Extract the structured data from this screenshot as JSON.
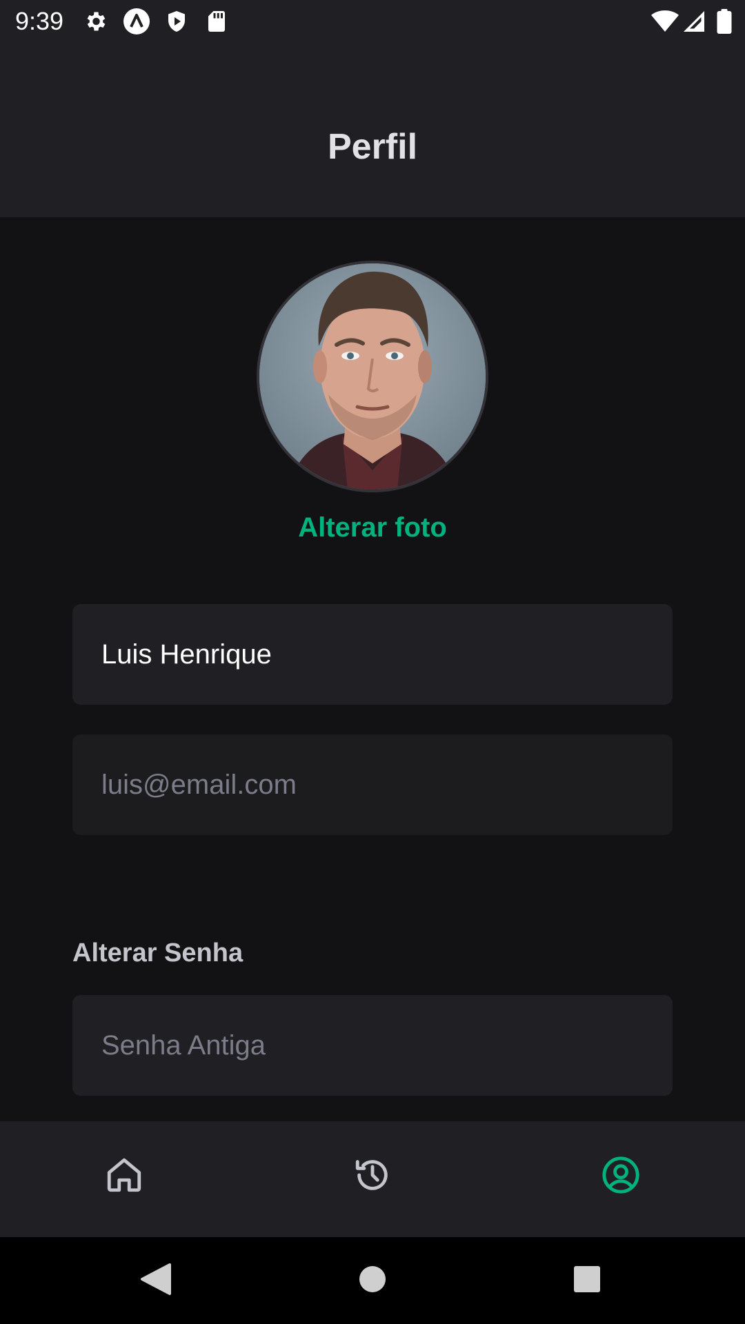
{
  "status_bar": {
    "time": "9:39",
    "icons": [
      "gear-icon",
      "a-logo-icon",
      "play-shield-icon",
      "sd-card-icon",
      "wifi-icon",
      "signal-icon",
      "battery-icon"
    ]
  },
  "header": {
    "title": "Perfil"
  },
  "profile": {
    "change_photo_label": "Alterar foto"
  },
  "form": {
    "name_value": "Luis Henrique",
    "email_value": "luis@email.com",
    "password_section_title": "Alterar Senha",
    "old_password_placeholder": "Senha Antiga"
  },
  "tab_bar": {
    "items": [
      "home-icon",
      "history-icon",
      "user-circle-icon"
    ],
    "active": "user-circle-icon"
  },
  "colors": {
    "accent": "#00b37e",
    "background": "#121214",
    "surface": "#202024",
    "muted_text": "#7c7c8a"
  }
}
